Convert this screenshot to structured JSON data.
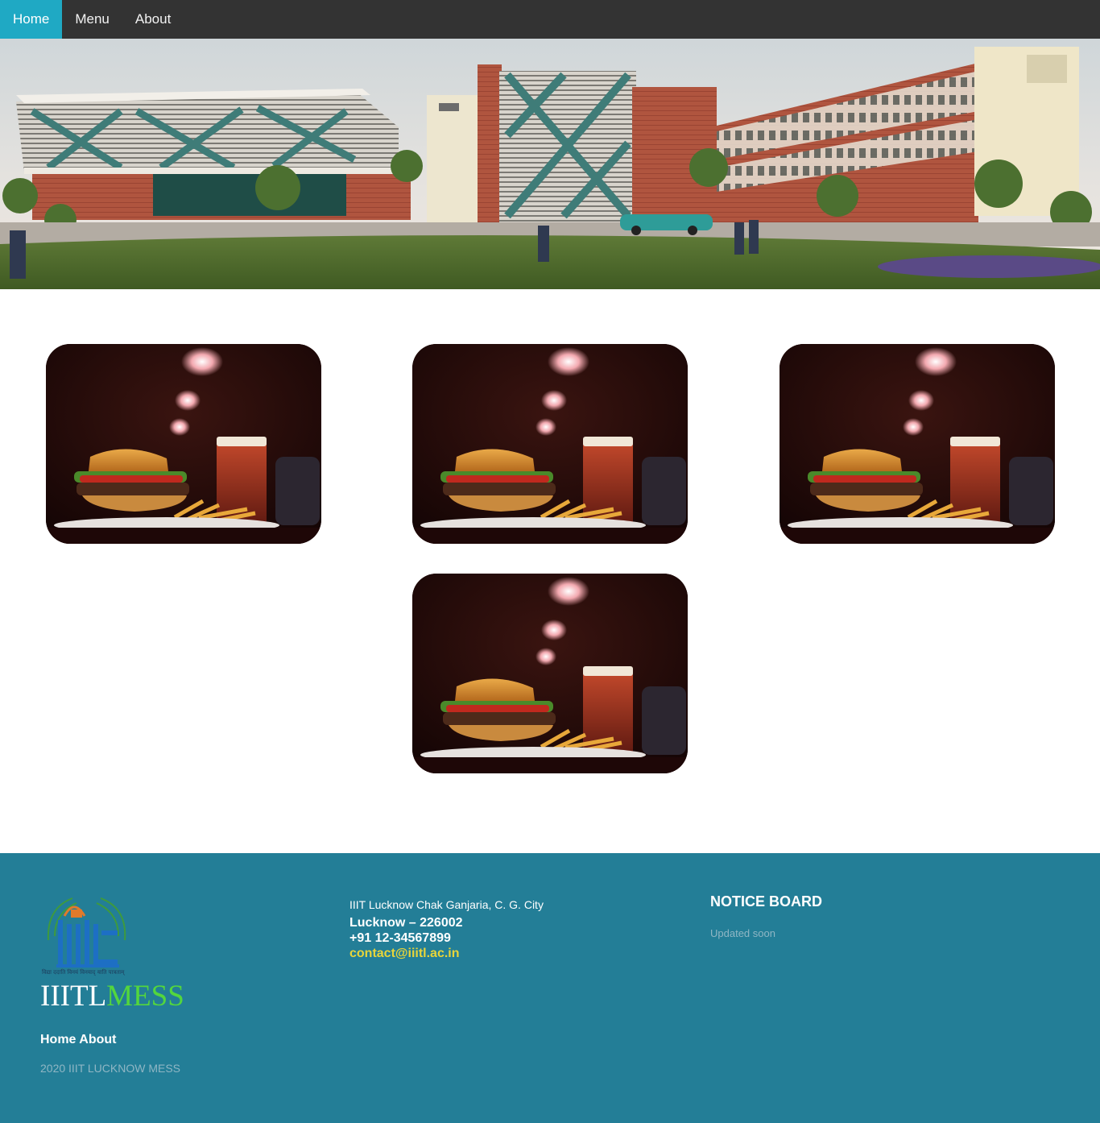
{
  "nav": {
    "items": [
      {
        "label": "Home",
        "active": true
      },
      {
        "label": "Menu",
        "active": false
      },
      {
        "label": "About",
        "active": false
      }
    ],
    "active_color": "#1fa9c4",
    "background": "#333333"
  },
  "hero": {
    "image": "campus-building-photo"
  },
  "gallery": {
    "image": "burger-fries-drink-photo",
    "count": 4
  },
  "footer": {
    "background": "#237e97",
    "logo": "iiitl-logo-icon",
    "brand_part1": "IIITL",
    "brand_part2": "MESS",
    "links_text": "Home About",
    "copyright": "2020 IIIT LUCKNOW MESS",
    "address_line1": "IIIT Lucknow Chak Ganjaria, C. G. City",
    "address_line2": "Lucknow – 226002",
    "phone": "+91 12-34567899",
    "email": "contact@iiitl.ac.in",
    "notice_title": "NOTICE BOARD",
    "notice_text": "Updated soon"
  }
}
